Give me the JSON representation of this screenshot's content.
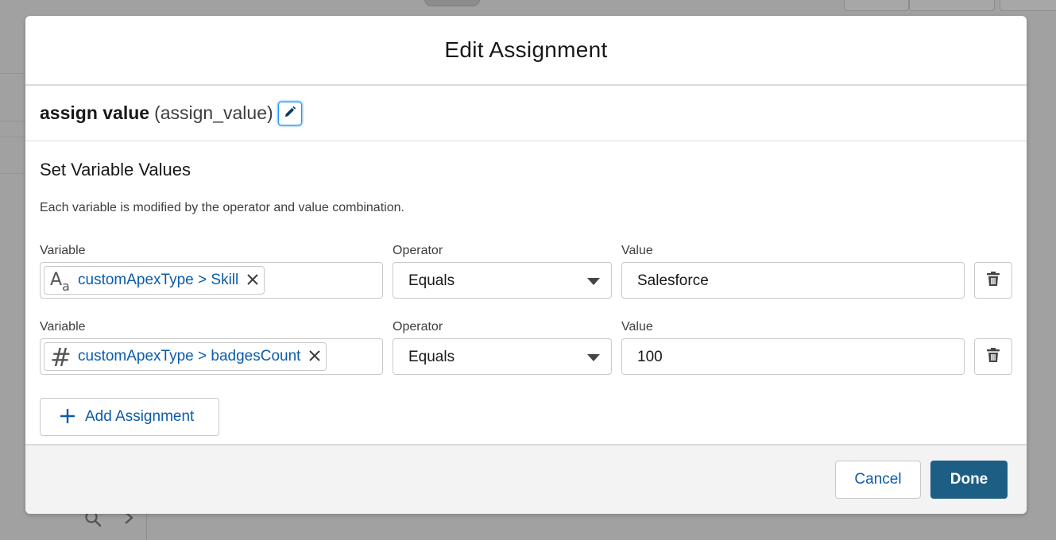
{
  "modal": {
    "title": "Edit Assignment",
    "element_label": "assign value",
    "element_api_name": "(assign_value)",
    "edit_icon": "pencil-icon"
  },
  "section": {
    "title": "Set Variable Values",
    "help": "Each variable is modified by the operator and value combination."
  },
  "assignments": [
    {
      "variable_label": "Variable",
      "variable_type_icon": "text-type-icon",
      "variable_value": "customApexType > Skill",
      "operator_label": "Operator",
      "operator_value": "Equals",
      "value_label": "Value",
      "value_value": "Salesforce",
      "delete_icon": "trash-icon"
    },
    {
      "variable_label": "Variable",
      "variable_type_icon": "number-type-icon",
      "variable_value": "customApexType > badgesCount",
      "operator_label": "Operator",
      "operator_value": "Equals",
      "value_label": "Value",
      "value_value": "100",
      "delete_icon": "trash-icon"
    }
  ],
  "add_assignment_label": "Add Assignment",
  "footer": {
    "cancel_label": "Cancel",
    "done_label": "Done"
  },
  "colors": {
    "link": "#0b5cab",
    "brand_button": "#1c5e84",
    "footer_bg": "#f3f3f3"
  }
}
